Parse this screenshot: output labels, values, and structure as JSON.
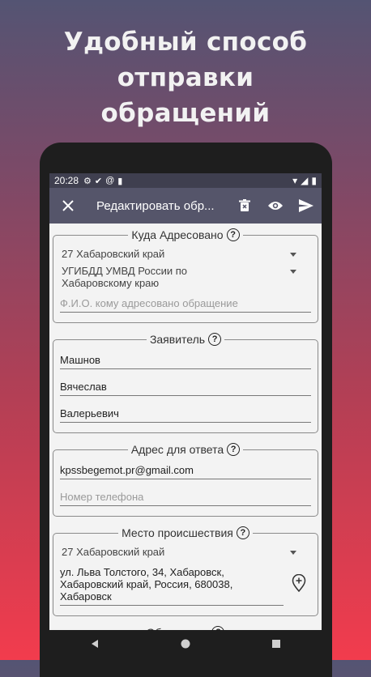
{
  "headline": {
    "line1": "Удобный способ отправки",
    "line2": "обращений"
  },
  "status_bar": {
    "time": "20:28"
  },
  "toolbar": {
    "title": "Редактировать обр..."
  },
  "section_recipient": {
    "title": "Куда Адресовано",
    "region": "27 Хабаровский край",
    "department": "УГИБДД УМВД России по Хабаровскому краю",
    "recipient_placeholder": "Ф.И.О. кому адресовано обращение"
  },
  "section_applicant": {
    "title": "Заявитель",
    "last_name": "Машнов",
    "first_name": "Вячеслав",
    "middle_name": "Валерьевич"
  },
  "section_reply": {
    "title": "Адрес для ответа",
    "email": "kpssbegemot.pr@gmail.com",
    "phone_placeholder": "Номер телефона"
  },
  "section_place": {
    "title": "Место происшествия",
    "region": "27 Хабаровский край",
    "address": "ул. Льва Толстого, 34, Хабаровск, Хабаровский край, Россия, 680038, Хабаровск"
  },
  "section_appeal": {
    "title": "Обращение"
  },
  "help_mark": "?"
}
